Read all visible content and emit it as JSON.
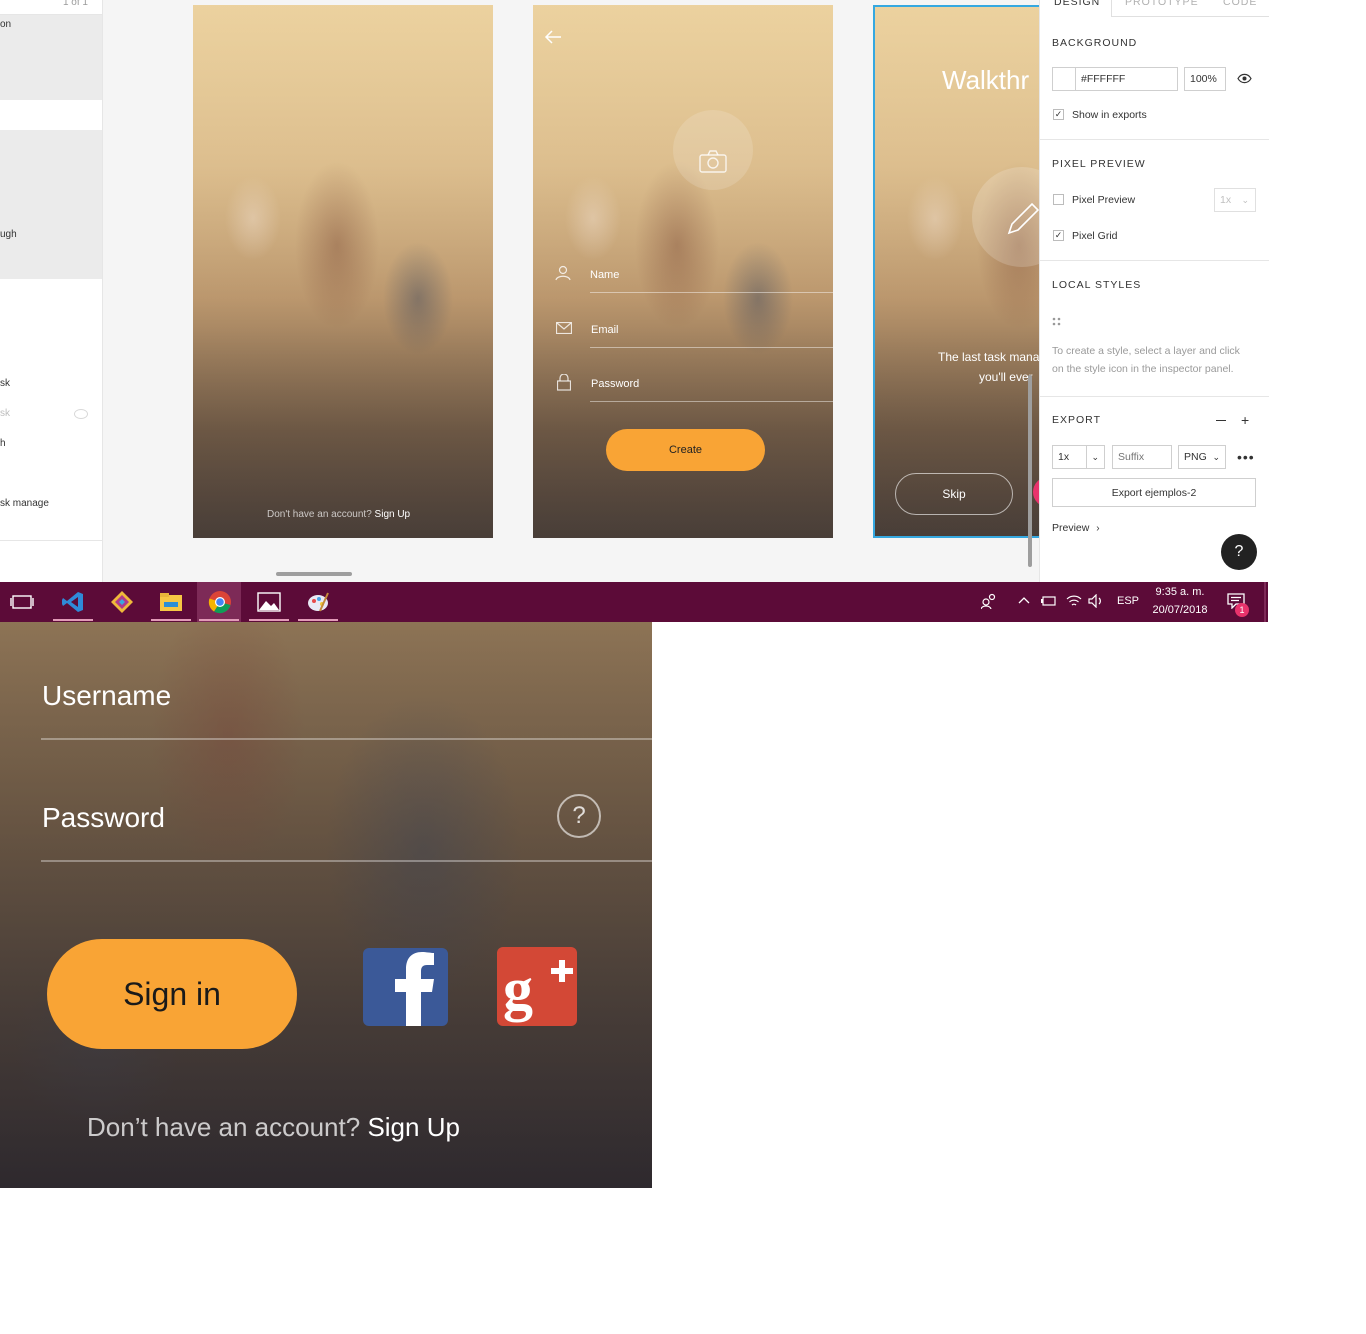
{
  "layers_panel": {
    "counter": "1 of 1",
    "items": [
      "on",
      "ugh",
      "sk",
      "sk",
      "h",
      "sk manage"
    ]
  },
  "artboards": {
    "login": {
      "footer_prefix": "Don't have an account?",
      "footer_link": "Sign Up"
    },
    "signup": {
      "fields": [
        "Name",
        "Email",
        "Password"
      ],
      "create_button": "Create"
    },
    "walkthrough": {
      "title": "Walkthr",
      "tagline_line1": "The last task mana",
      "tagline_line2": "you'll ever",
      "skip_button": "Skip"
    }
  },
  "inspector": {
    "tabs": [
      "DESIGN",
      "PROTOTYPE",
      "CODE"
    ],
    "background": {
      "title": "BACKGROUND",
      "color": "#FFFFFF",
      "opacity": "100%",
      "show_in_exports": "Show in exports"
    },
    "pixel_preview": {
      "title": "PIXEL PREVIEW",
      "pixel_preview_label": "Pixel Preview",
      "pixel_preview_scale": "1x",
      "pixel_grid_label": "Pixel Grid"
    },
    "local_styles": {
      "title": "LOCAL STYLES",
      "hint": "To create a style, select a layer and click on the style icon in the inspector panel."
    },
    "export": {
      "title": "EXPORT",
      "scale": "1x",
      "suffix_placeholder": "Suffix",
      "format": "PNG",
      "export_button": "Export ejemplos-2",
      "preview_label": "Preview"
    },
    "help": "?"
  },
  "taskbar": {
    "language": "ESP",
    "time": "9:35 a. m.",
    "date": "20/07/2018",
    "notifications": "1"
  },
  "zoomed_login": {
    "username_label": "Username",
    "password_label": "Password",
    "help_icon": "?",
    "signin_button": "Sign in",
    "footer_prefix": "Don’t have an account?",
    "footer_link": "Sign Up"
  },
  "colors": {
    "accent_orange": "#f9a435",
    "taskbar": "#5c0b38",
    "facebook": "#3b5998",
    "google_plus": "#d34836",
    "selection_blue": "#35a8e0"
  }
}
